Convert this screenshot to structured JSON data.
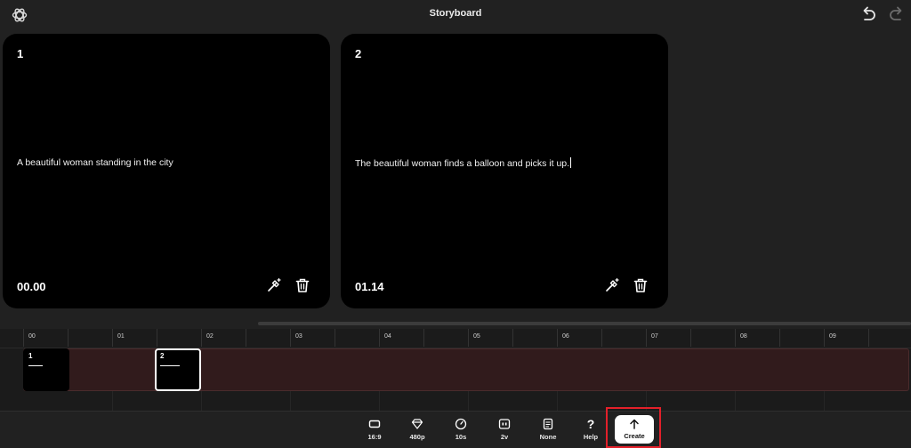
{
  "header": {
    "title": "Storyboard",
    "logo_icon": "openai-logo-icon",
    "undo_icon": "undo-icon",
    "redo_icon": "redo-icon"
  },
  "cards": [
    {
      "number": "1",
      "text": "A beautiful woman standing in the city",
      "time": "00.00",
      "edit_icon": "edit-wand-icon",
      "delete_icon": "trash-icon"
    },
    {
      "number": "2",
      "text": "The beautiful woman finds a balloon and picks it up.",
      "time": "01.14",
      "edit_icon": "edit-wand-icon",
      "delete_icon": "trash-icon"
    }
  ],
  "timeline": {
    "ticks": [
      "00",
      "01",
      "02",
      "03",
      "04",
      "05",
      "06",
      "07",
      "08",
      "09"
    ],
    "clips": [
      {
        "number": "1"
      },
      {
        "number": "2",
        "selected": true
      }
    ]
  },
  "toolbar": {
    "items": [
      {
        "label": "16:9",
        "icon": "aspect-ratio-icon"
      },
      {
        "label": "480p",
        "icon": "diamond-icon"
      },
      {
        "label": "10s",
        "icon": "timer-icon"
      },
      {
        "label": "2v",
        "icon": "variations-icon"
      },
      {
        "label": "None",
        "icon": "preset-icon"
      },
      {
        "label": "Help",
        "icon": "help-icon",
        "glyph": "?"
      }
    ],
    "create": {
      "label": "Create",
      "icon": "arrow-up-icon"
    }
  },
  "colors": {
    "background": "#212121",
    "card": "#000000",
    "track": "#311b1c",
    "highlight": "#e3202a"
  }
}
